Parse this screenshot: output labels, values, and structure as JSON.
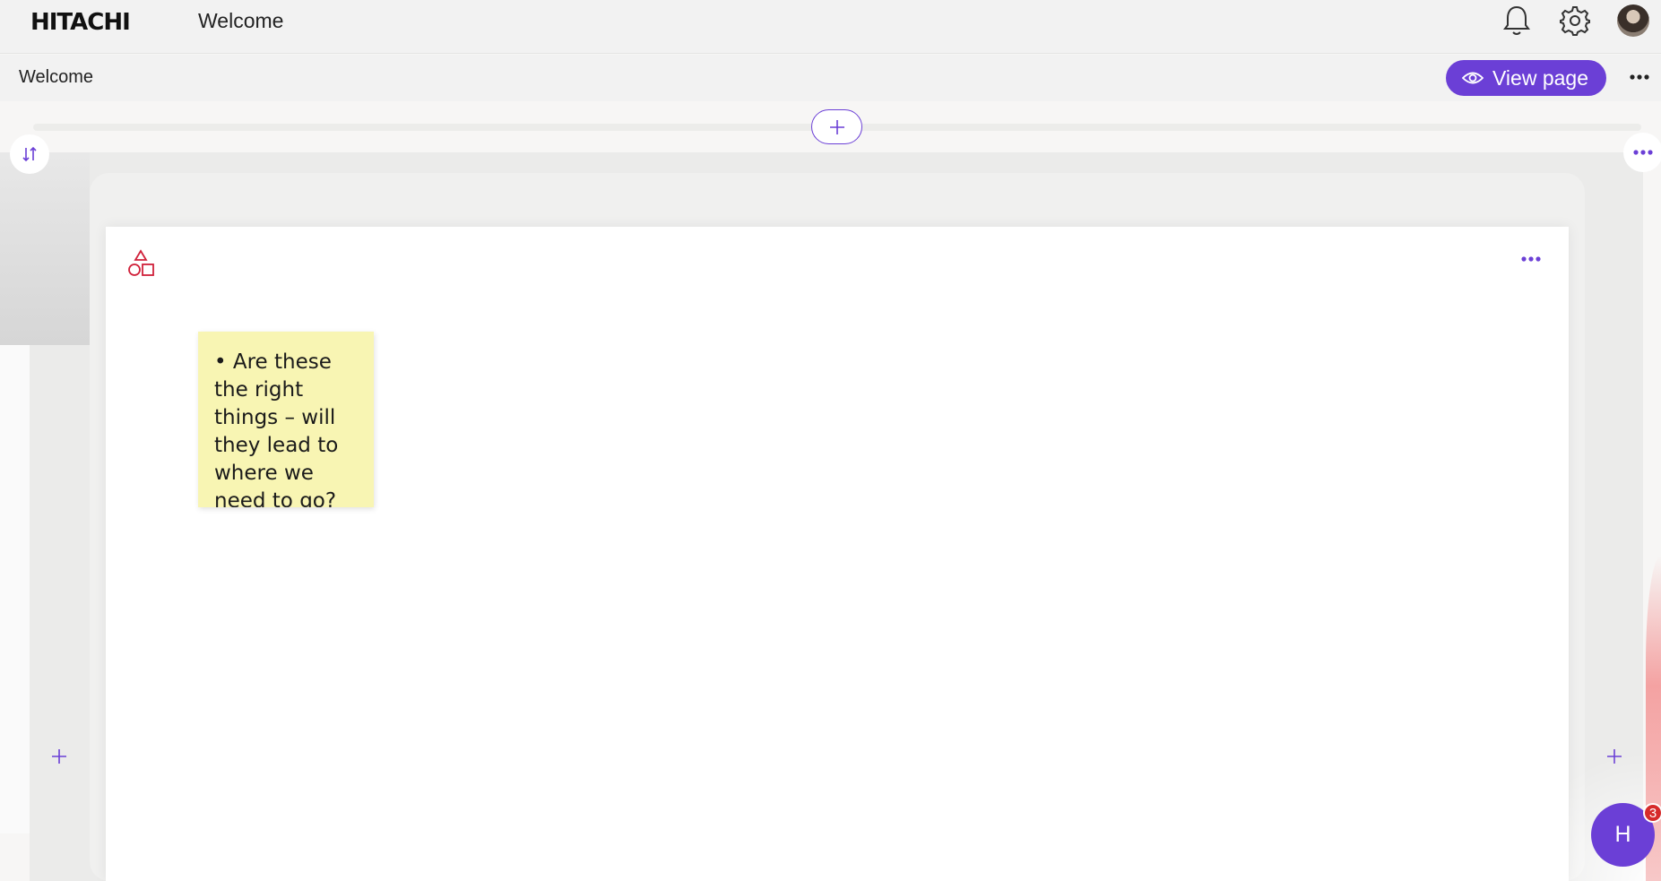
{
  "header": {
    "logo": "HITACHI",
    "title": "Welcome",
    "icons": [
      "bell-icon",
      "gear-icon",
      "avatar"
    ]
  },
  "subbar": {
    "page_name": "Welcome",
    "view_page_label": "View page",
    "icons": [
      "eye-icon",
      "more-horizontal-icon"
    ]
  },
  "canvas": {
    "section_controls": [
      "plus-icon",
      "sort-arrows-icon",
      "more-horizontal-icon"
    ],
    "card": {
      "icon": "shapes-icon",
      "sticky_note": {
        "text": "• Are these the right things – will they lead to where we need to go?",
        "color": "#f8f5b3"
      }
    }
  },
  "help": {
    "label": "H",
    "badge": "3"
  },
  "colors": {
    "accent": "#6b3fd6",
    "badge": "#d62b2b",
    "shapes_icon": "#d0213a"
  }
}
